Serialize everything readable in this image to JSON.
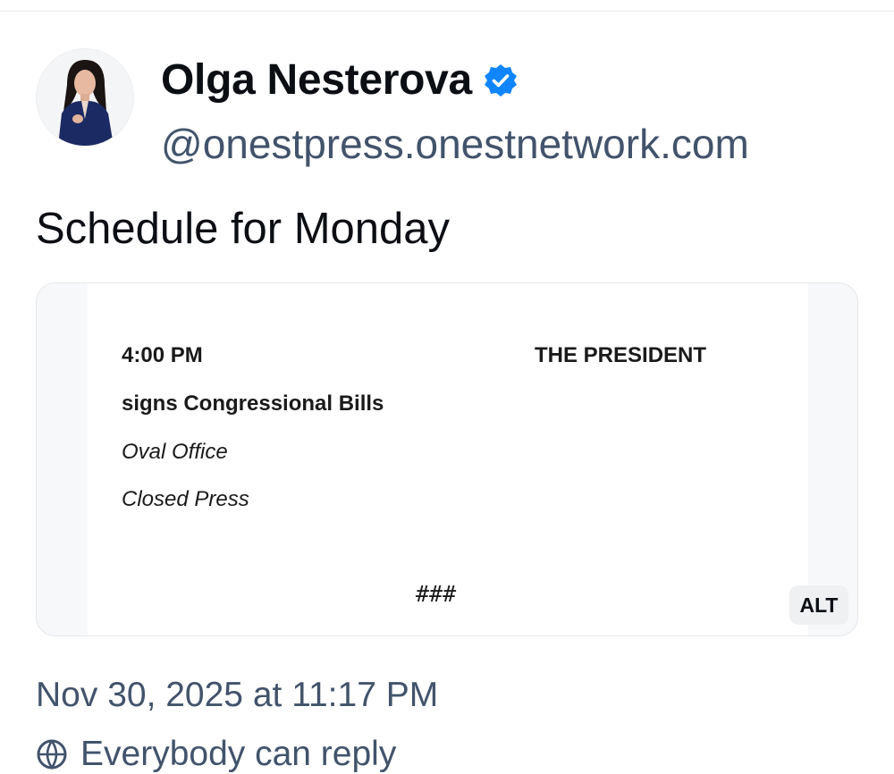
{
  "post": {
    "author_name": "Olga Nesterova",
    "author_handle": "@onestpress.onestnetwork.com",
    "text": "Schedule for Monday",
    "timestamp": "Nov 30, 2025 at 11:17 PM",
    "reply_setting": "Everybody can reply"
  },
  "image": {
    "time": "4:00 PM",
    "subject": "THE PRESIDENT",
    "event": "signs Congressional Bills",
    "location": "Oval Office",
    "press": "Closed Press",
    "end_mark": "###",
    "alt_label": "ALT"
  },
  "icons": {
    "verified": "verified-checkmark-icon",
    "reply": "globe-icon"
  },
  "colors": {
    "accent": "#1185fe",
    "secondary_text": "#42536b"
  }
}
